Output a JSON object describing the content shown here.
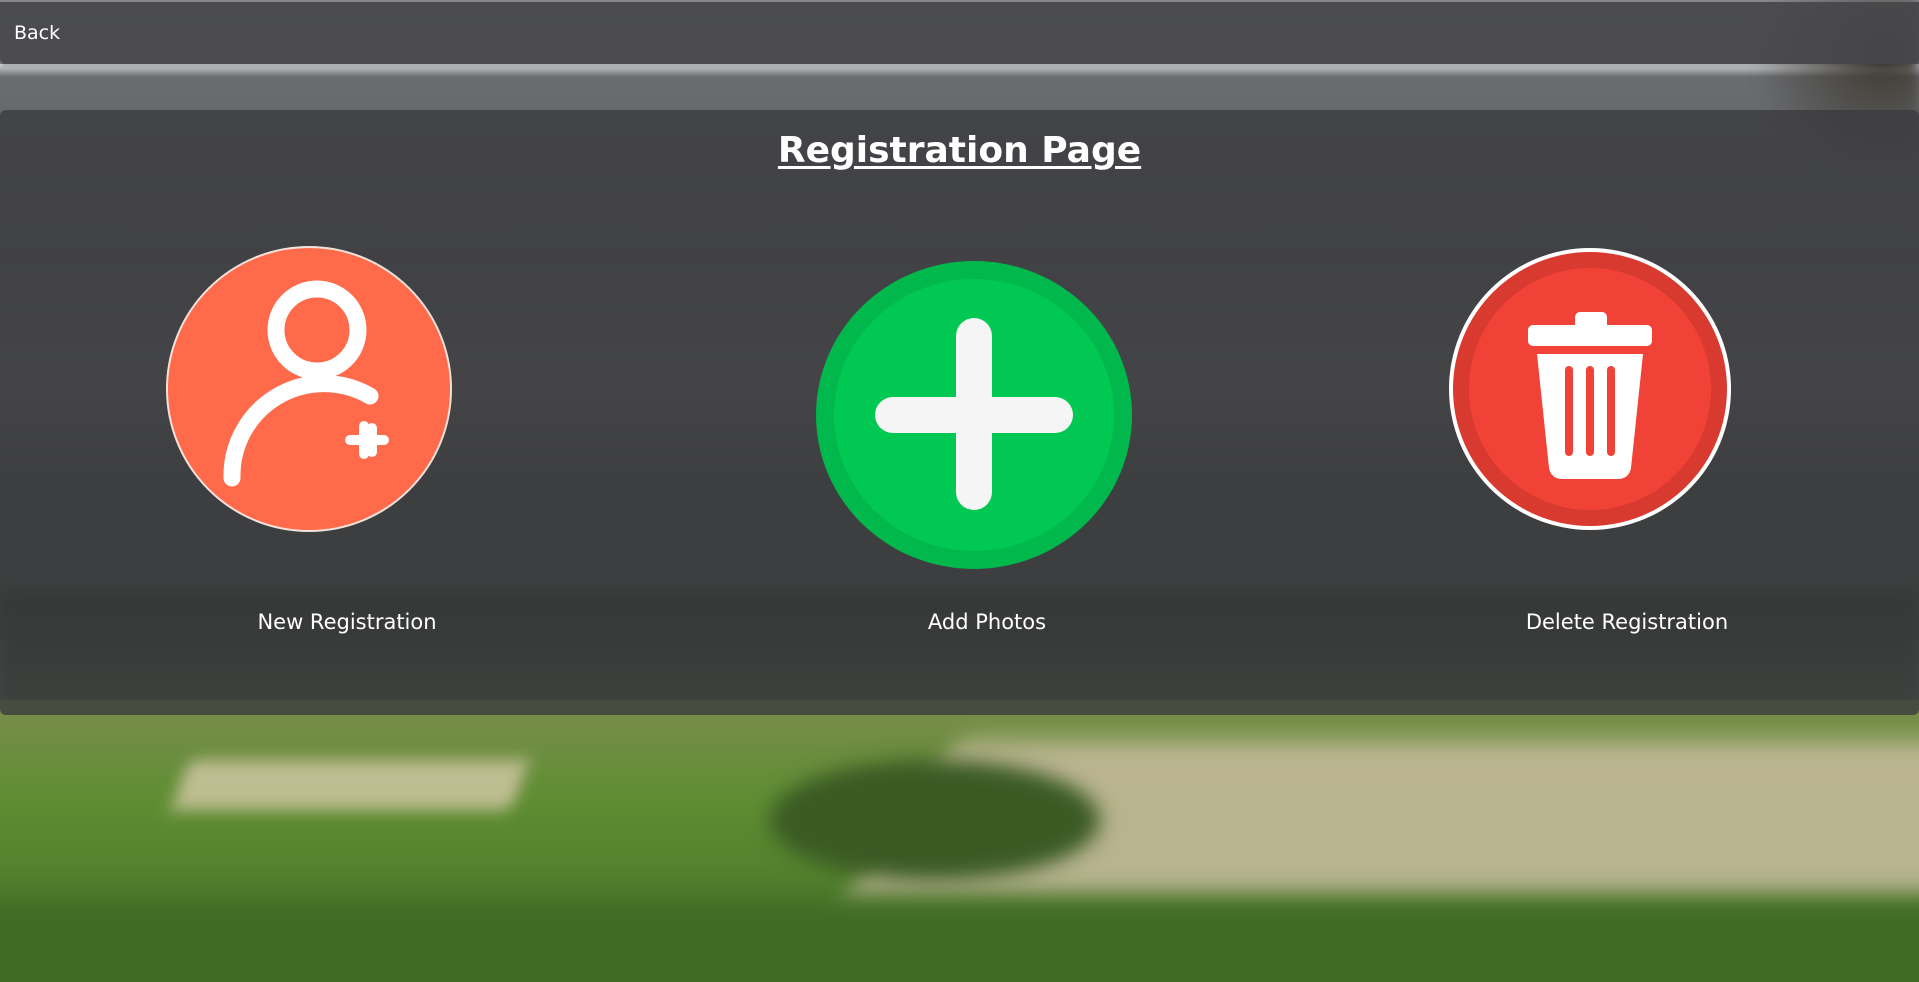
{
  "header": {
    "back_label": "Back"
  },
  "page": {
    "title": "Registration Page"
  },
  "actions": [
    {
      "label": "New Registration",
      "icon": "add-user-icon",
      "color": "#ff6a4a"
    },
    {
      "label": "Add Photos",
      "icon": "plus-icon",
      "color": "#00c853"
    },
    {
      "label": "Delete Registration",
      "icon": "trash-icon",
      "color": "#f04236"
    }
  ]
}
